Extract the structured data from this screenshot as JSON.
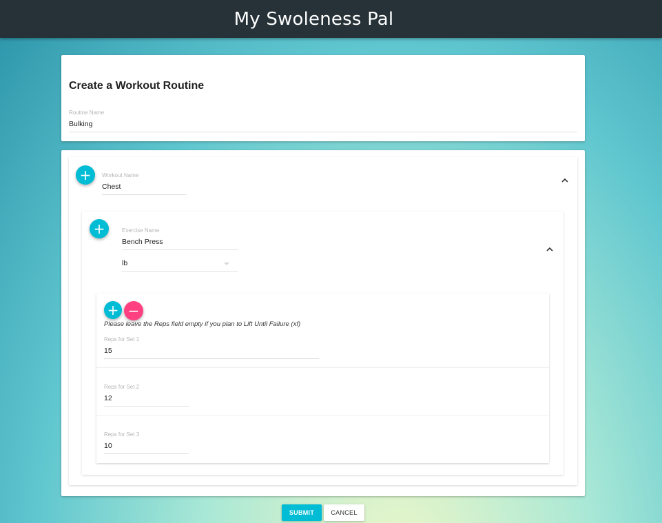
{
  "app": {
    "title": "My Swoleness Pal"
  },
  "routine": {
    "heading": "Create a Workout Routine",
    "name_label": "Routine Name",
    "name_value": "Bulking"
  },
  "workout": {
    "name_label": "Workout Name",
    "name_value": "Chest",
    "add_icon": "plus-icon",
    "collapse_icon": "chevron-up-icon"
  },
  "exercise": {
    "name_label": "Exercise Name",
    "name_value": "Bench Press",
    "unit_value": "lb",
    "add_icon": "plus-icon",
    "collapse_icon": "chevron-up-icon"
  },
  "sets": {
    "hint": "Please leave the Reps field empty if you plan to Lift Until Failure (xf)",
    "add_symbol": "+",
    "remove_symbol": "−",
    "items": [
      {
        "label": "Reps for Set 1",
        "value": "15"
      },
      {
        "label": "Reps for Set 2",
        "value": "12"
      },
      {
        "label": "Reps for Set 3",
        "value": "10"
      }
    ]
  },
  "actions": {
    "submit_label": "SUBMIT",
    "cancel_label": "CANCEL"
  },
  "colors": {
    "appbar": "#263238",
    "accent": "#00bcd4",
    "remove": "#ff4081"
  }
}
